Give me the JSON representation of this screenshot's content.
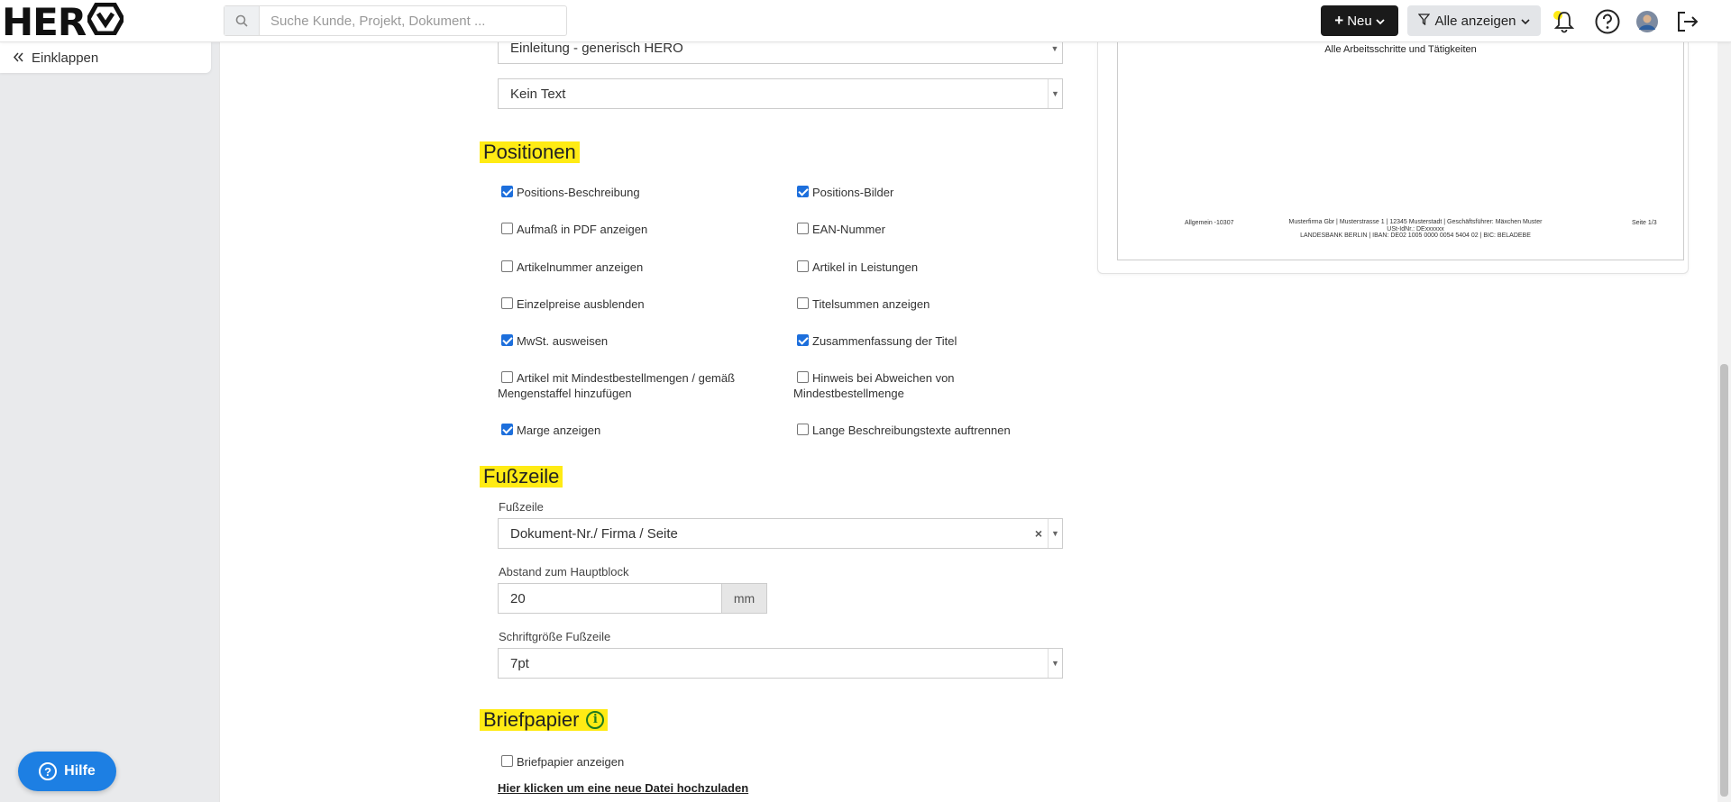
{
  "app": {
    "logo_text": "HER"
  },
  "header": {
    "search_placeholder": "Suche Kunde, Projekt, Dokument ...",
    "new_button": "Neu",
    "filter_button": "Alle anzeigen"
  },
  "sidebar": {
    "collapse_label": "Einklappen",
    "help_label": "Hilfe"
  },
  "form": {
    "intro_template": "Einleitung - generisch HERO",
    "text_select": "Kein Text",
    "positions": {
      "title": "Positionen",
      "options": [
        {
          "label": "Positions-Beschreibung",
          "checked": true
        },
        {
          "label": "Positions-Bilder",
          "checked": true
        },
        {
          "label": "Aufmaß in PDF anzeigen",
          "checked": false
        },
        {
          "label": "EAN-Nummer",
          "checked": false
        },
        {
          "label": "Artikelnummer anzeigen",
          "checked": false
        },
        {
          "label": "Artikel in Leistungen",
          "checked": false
        },
        {
          "label": "Einzelpreise ausblenden",
          "checked": false
        },
        {
          "label": "Titelsummen anzeigen",
          "checked": false
        },
        {
          "label": "MwSt. ausweisen",
          "checked": true
        },
        {
          "label": "Zusammenfassung der Titel",
          "checked": true
        },
        {
          "label_line1": "Artikel mit Mindestbestellmengen / gemäß",
          "label_line2": "Mengenstaffel hinzufügen",
          "checked": false
        },
        {
          "label_line1": "Hinweis bei Abweichen von",
          "label_line2": "Mindestbestellmenge",
          "checked": false
        },
        {
          "label": "Marge anzeigen",
          "checked": true
        },
        {
          "label": "Lange Beschreibungstexte auftrennen",
          "checked": false
        }
      ]
    },
    "footer": {
      "title": "Fußzeile",
      "footer_label": "Fußzeile",
      "footer_value": "Dokument-Nr./ Firma / Seite",
      "distance_label": "Abstand zum Hauptblock",
      "distance_value": "20",
      "distance_unit": "mm",
      "fontsize_label": "Schriftgröße Fußzeile",
      "fontsize_value": "7pt"
    },
    "letterhead": {
      "title": "Briefpapier",
      "show_label": "Briefpapier anzeigen",
      "show_checked": false,
      "upload_link": "Hier klicken um eine neue Datei hochzuladen"
    }
  },
  "preview": {
    "heading": "Alle Arbeitsschritte und Tätigkeiten",
    "footer_left": "Allgemein -10307",
    "footer_mid_line1": "Musterfirma Gbr | Musterstrasse 1 | 12345 Musterstadt | Geschäftsführer: Mäxchen Muster",
    "footer_mid_line2": "USt-IdNr.: DExxxxxx",
    "footer_mid_line3": "LANDESBANK BERLIN | IBAN: DE02 1005 0000 0054 5404 02 | BIC: BELADEBE",
    "footer_right": "Seite 1/3"
  },
  "colors": {
    "highlight": "#ffeb14",
    "primary": "#1d7fe3",
    "dark_button": "#1a1a1a"
  }
}
